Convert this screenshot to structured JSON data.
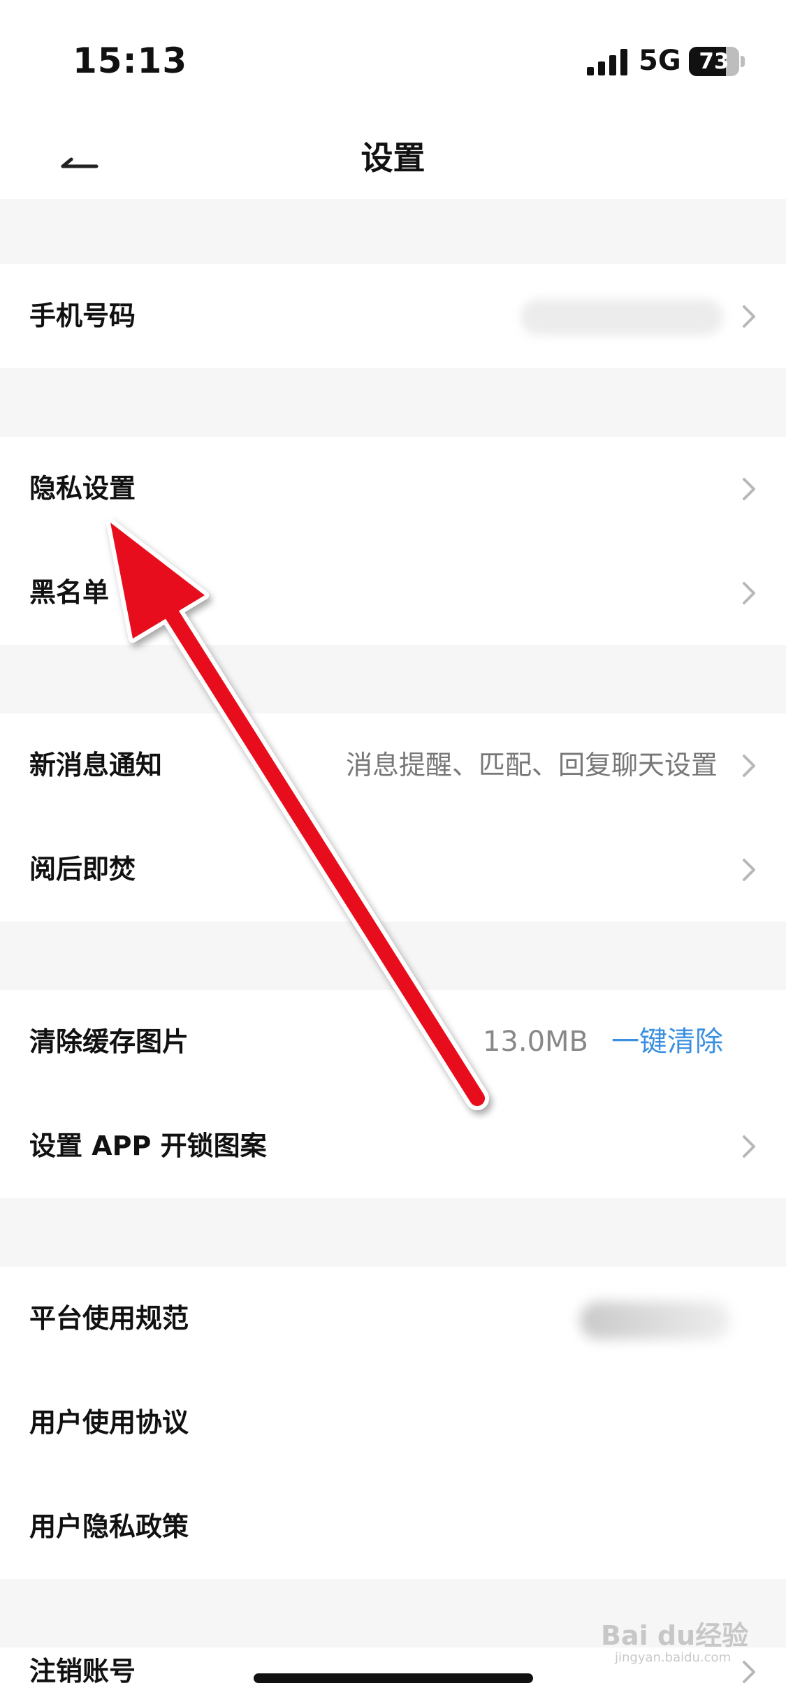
{
  "status_bar": {
    "time": "15:13",
    "network": "5G",
    "battery": "73",
    "battery_level": 0.73
  },
  "nav": {
    "title": "设置",
    "back_icon": "back-arrow-icon"
  },
  "sections": {
    "account": {
      "phone_label": "手机号码"
    },
    "privacy": {
      "privacy_label": "隐私设置",
      "blacklist_label": "黑名单"
    },
    "notify": {
      "notification_label": "新消息通知",
      "notification_value": "消息提醒、匹配、回复聊天设置",
      "burn_label": "阅后即焚"
    },
    "storage": {
      "cache_label": "清除缓存图片",
      "cache_size": "13.0MB",
      "cache_action": "一键清除",
      "lock_label": "设置 APP 开锁图案"
    },
    "legal": {
      "norms_label": "平台使用规范",
      "agreement_label": "用户使用协议",
      "policy_label": "用户隐私政策"
    },
    "danger": {
      "cancel_label": "注销账号"
    }
  },
  "watermark": {
    "text": "Bai du经验",
    "url": "jingyan.baidu.com"
  },
  "colors": {
    "accent": "#3b8fe0",
    "arrow": "#e8101a",
    "background": "#f6f6f6"
  }
}
